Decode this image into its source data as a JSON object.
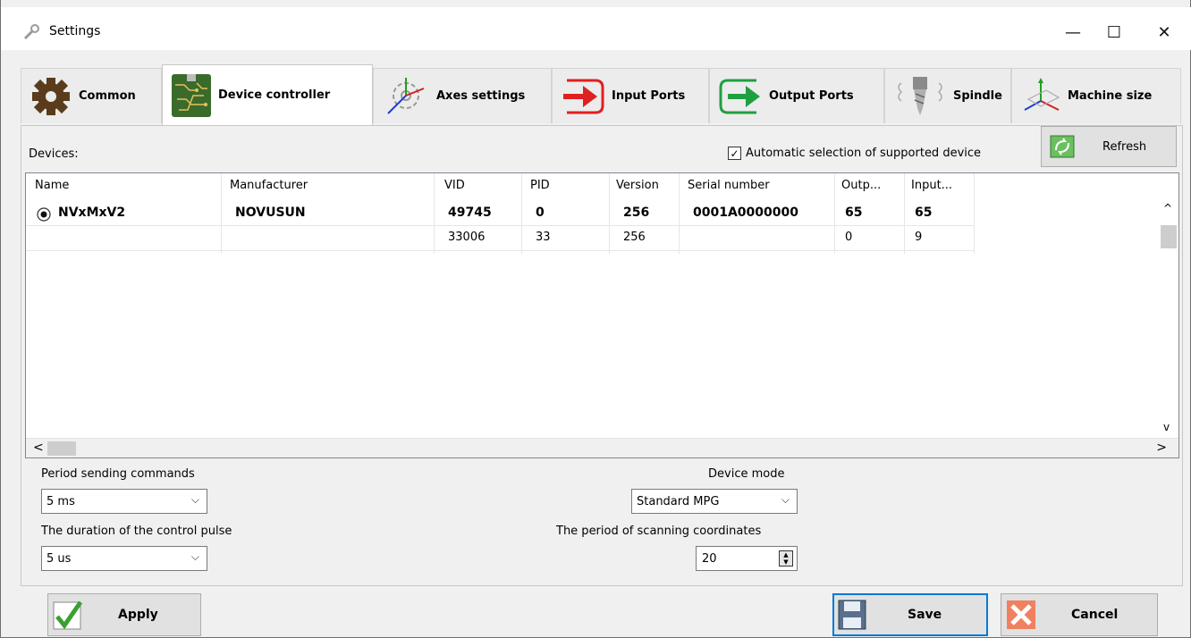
{
  "window": {
    "title": "Settings",
    "minimize_glyph": "—",
    "maximize_glyph": "☐",
    "close_glyph": "✕"
  },
  "tabs": [
    {
      "label": "Common",
      "icon": "gear-icon"
    },
    {
      "label": "Device controller",
      "icon": "circuit-board-icon",
      "active": true
    },
    {
      "label": "Axes settings",
      "icon": "axes-gear-icon"
    },
    {
      "label": "Input Ports",
      "icon": "input-arrow-icon"
    },
    {
      "label": "Output Ports",
      "icon": "output-arrow-icon"
    },
    {
      "label": "Spindle",
      "icon": "spindle-icon"
    },
    {
      "label": "Machine size",
      "icon": "machine-axes-icon"
    }
  ],
  "devices": {
    "label": "Devices:",
    "auto_select_label": "Automatic selection of supported device",
    "auto_select_checked": true,
    "refresh_label": "Refresh",
    "columns": [
      "Name",
      "Manufacturer",
      "VID",
      "PID",
      "Version",
      "Serial number",
      "Outp...",
      "Input..."
    ],
    "rows": [
      {
        "name": "NVxMxV2",
        "manufacturer": "NOVUSUN",
        "vid": "49745",
        "pid": "0",
        "version": "256",
        "serial": "0001A0000000",
        "outputs": "65",
        "inputs": "65",
        "selected": true
      },
      {
        "name": "",
        "manufacturer": "",
        "vid": "33006",
        "pid": "33",
        "version": "256",
        "serial": "",
        "outputs": "0",
        "inputs": "9",
        "selected": false
      }
    ]
  },
  "settings": {
    "period_label": "Period sending commands",
    "period_value": "5 ms",
    "pulse_label": "The duration of the control pulse",
    "pulse_value": "5 us",
    "mode_label": "Device mode",
    "mode_value": "Standard MPG",
    "scan_label": "The period of scanning coordinates",
    "scan_value": "20"
  },
  "buttons": {
    "apply": "Apply",
    "save": "Save",
    "cancel": "Cancel"
  },
  "colors": {
    "focus_border": "#0078d7",
    "input_port_red": "#e02020",
    "output_port_green": "#1fa040",
    "board_green": "#3a6b2a"
  }
}
